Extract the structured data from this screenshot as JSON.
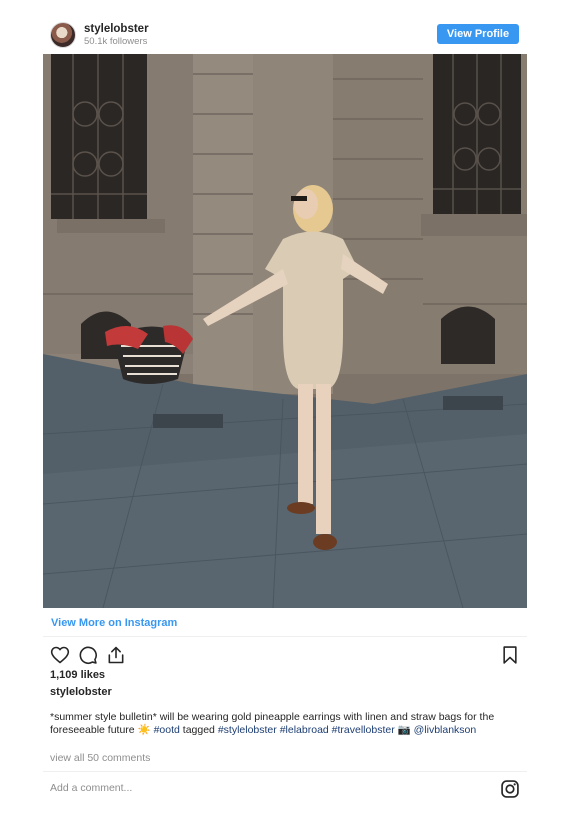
{
  "header": {
    "username": "stylelobster",
    "followers": "50.1k followers",
    "view_profile_label": "View Profile"
  },
  "post": {
    "image_icon": "photo-image",
    "view_more_label": "View More on Instagram",
    "likes": "1,109 likes",
    "caption_user": "stylelobster",
    "caption_text": "*summer style bulletin* will be wearing gold pineapple earrings with linen and straw bags for the foreseeable future",
    "caption_emoji": "☀️",
    "caption_tagged": "tagged",
    "hashtags": [
      "#ootd",
      "#stylelobster",
      "#lelabroad",
      "#travellobster"
    ],
    "camera_emoji": "📷",
    "mention": "@livblankson",
    "view_comments": "view all 50 comments",
    "add_comment_placeholder": "Add a comment..."
  },
  "icons": {
    "like": "heart-icon",
    "comment": "comment-icon",
    "share": "share-icon",
    "save": "bookmark-icon",
    "instagram": "instagram-icon"
  },
  "colors": {
    "accent": "#3897f0",
    "hashtag": "#1d3e73",
    "muted": "#8e8e8e"
  }
}
